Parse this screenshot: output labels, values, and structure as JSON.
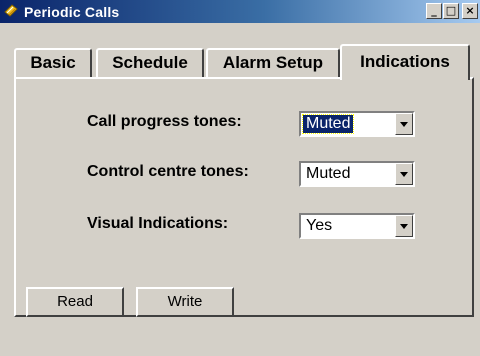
{
  "window": {
    "title": "Periodic Calls",
    "controls": {
      "minimize": "_",
      "maximize": "□",
      "close": "×"
    }
  },
  "tabs": [
    {
      "label": "Basic",
      "active": false
    },
    {
      "label": "Schedule",
      "active": false
    },
    {
      "label": "Alarm Setup",
      "active": false
    },
    {
      "label": "Indications",
      "active": true
    }
  ],
  "settings": {
    "call_progress": {
      "label": "Call progress tones:",
      "value": "Muted"
    },
    "control_centre": {
      "label": "Control centre tones:",
      "value": "Muted"
    },
    "visual": {
      "label": "Visual Indications:",
      "value": "Yes"
    }
  },
  "buttons": {
    "read": "Read",
    "write": "Write"
  },
  "colors": {
    "face": "#d4d0c8",
    "title_start": "#0a246a",
    "title_end": "#a6caf0",
    "selection": "#0a246a"
  },
  "icons": {
    "app": "periodic-calls-app-icon",
    "dropdown": "dropdown-arrow-icon"
  }
}
